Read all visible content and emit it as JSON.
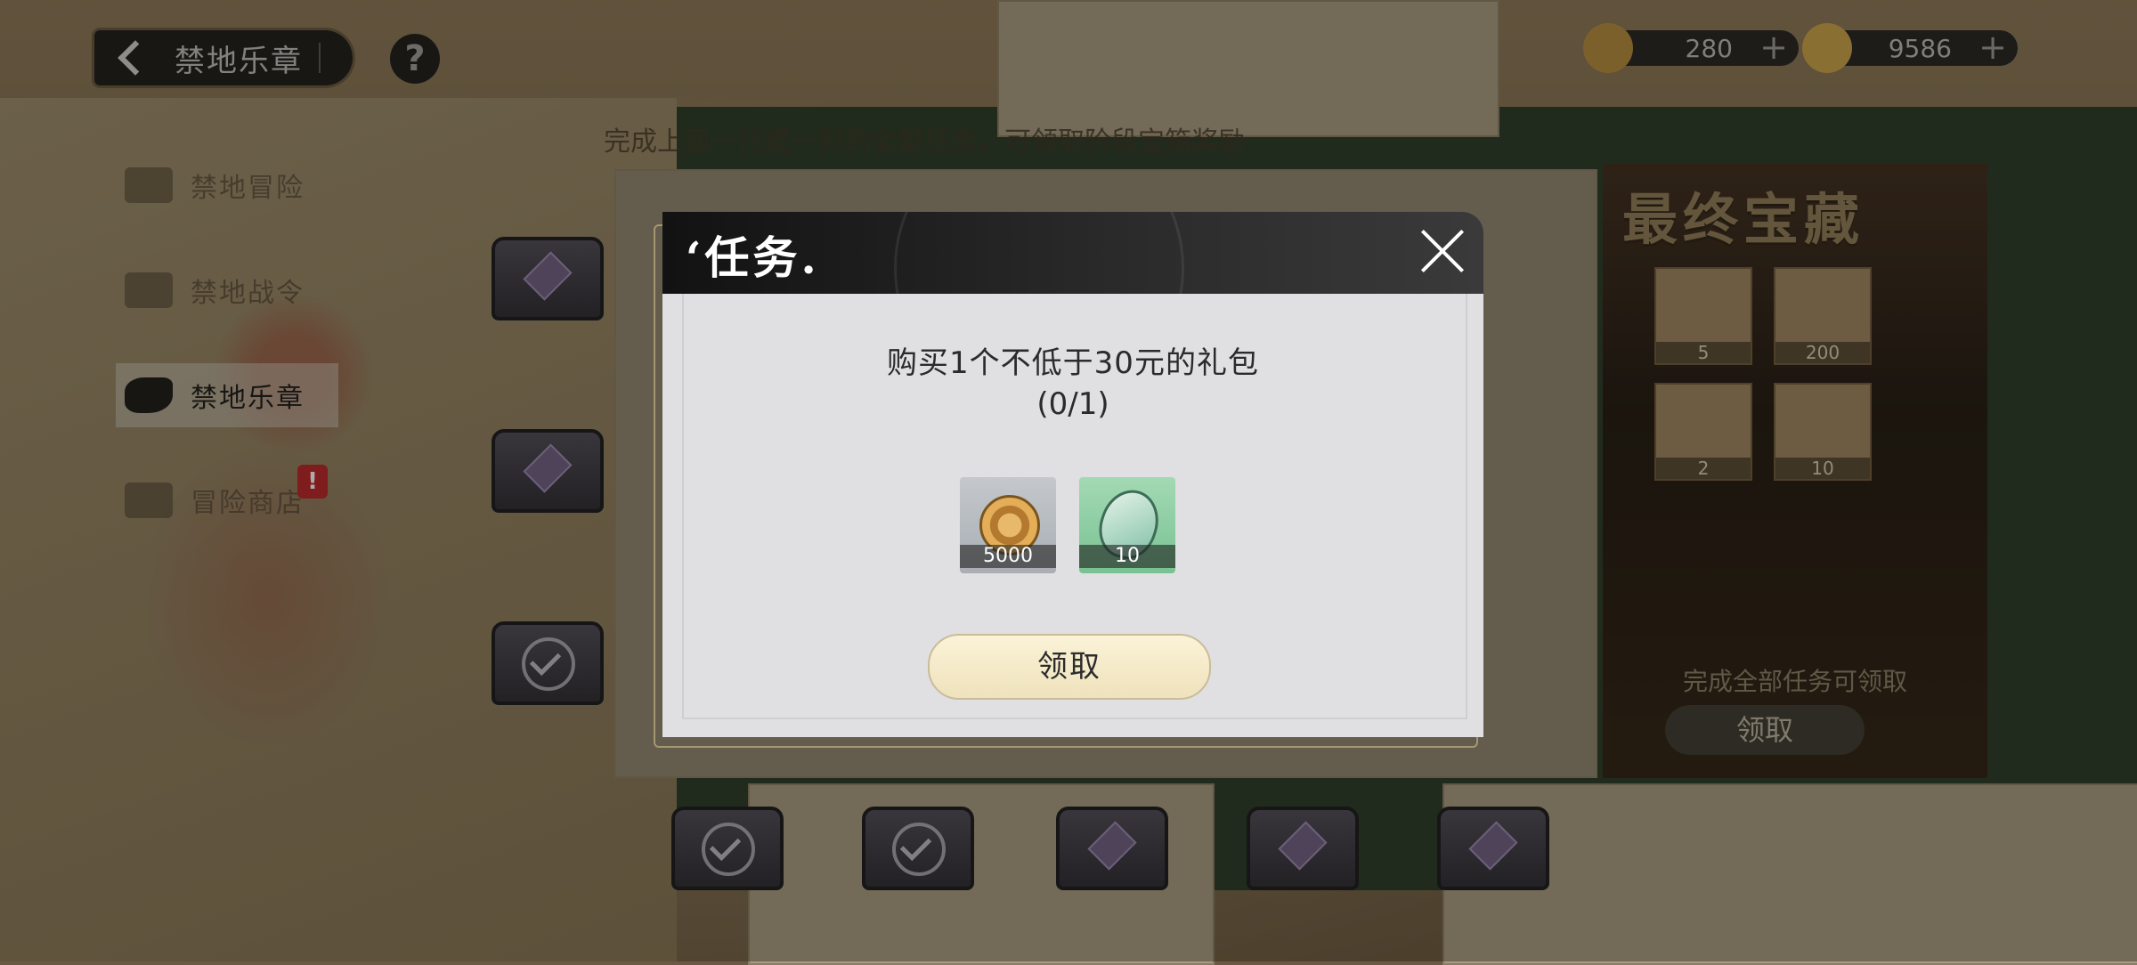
{
  "header": {
    "back_label": "禁地乐章",
    "help_label": "?",
    "currencies": [
      {
        "value": "280",
        "icon": "bell-coin-icon"
      },
      {
        "value": "9586",
        "icon": "lantern-coin-icon"
      }
    ]
  },
  "hint_text": "完成上面一行或一列的全部任务，可领取阶段宝箱奖励",
  "sidebar": {
    "items": [
      {
        "label": "禁地冒险"
      },
      {
        "label": "禁地战令"
      },
      {
        "label": "禁地乐章"
      },
      {
        "label": "冒险商店"
      }
    ],
    "shop_badge": "!"
  },
  "final_treasure": {
    "title": "最终宝藏",
    "items": [
      {
        "icon": "dice-icon",
        "count": "5"
      },
      {
        "icon": "lantern-icon",
        "count": "200"
      },
      {
        "icon": "flame-orb-icon",
        "count": "2"
      },
      {
        "icon": "bird-icon",
        "count": "10"
      }
    ],
    "text": "完成全部任务可领取",
    "button": "领取"
  },
  "modal": {
    "title": "‘任务.",
    "task_desc": "购买1个不低于30元的礼包",
    "progress": "(0/1)",
    "rewards": [
      {
        "icon": "gold-coin-icon",
        "count": "5000"
      },
      {
        "icon": "egg-icon",
        "count": "10"
      }
    ],
    "claim_label": "领取"
  }
}
